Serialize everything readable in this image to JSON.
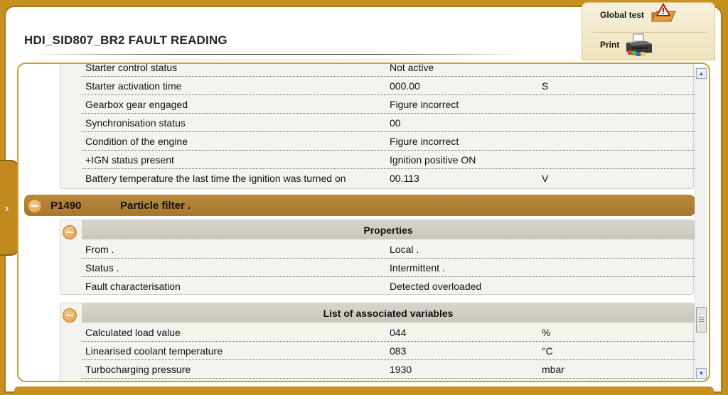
{
  "header": {
    "title": "HDI_SID807_BR2  FAULT READING"
  },
  "toolbar": {
    "global_test_label": "Global test",
    "print_label": "Print"
  },
  "top_rows": [
    {
      "name": "Starter control status",
      "value": "Not active",
      "unit": ""
    },
    {
      "name": "Starter activation time",
      "value": "000.00",
      "unit": "S"
    },
    {
      "name": "Gearbox gear engaged",
      "value": "Figure incorrect",
      "unit": ""
    },
    {
      "name": "Synchronisation status",
      "value": "00",
      "unit": ""
    },
    {
      "name": "Condition of the engine",
      "value": "Figure incorrect",
      "unit": ""
    },
    {
      "name": "+IGN status present",
      "value": "Ignition positive ON",
      "unit": ""
    },
    {
      "name": "Battery temperature the last time the ignition was turned on",
      "value": "00.113",
      "unit": "V"
    }
  ],
  "fault": {
    "code": "P1490",
    "name": "Particle filter ."
  },
  "properties": {
    "header": "Properties",
    "rows": [
      {
        "name": "From .",
        "value": "Local ."
      },
      {
        "name": "Status .",
        "value": "Intermittent ."
      },
      {
        "name": "Fault characterisation",
        "value": "Detected overloaded"
      }
    ]
  },
  "variables": {
    "header": "List of associated variables",
    "rows": [
      {
        "name": "Calculated load value",
        "value": "044",
        "unit": "%"
      },
      {
        "name": "Linearised coolant temperature",
        "value": "083",
        "unit": "°C"
      },
      {
        "name": "Turbocharging pressure",
        "value": "1930",
        "unit": "mbar"
      }
    ]
  },
  "colors": {
    "frame": "#c8901c",
    "fault_bar": "#a8792c",
    "minus_button": "#e39a42"
  },
  "icons": {
    "global_test": "warning-folder-icon",
    "print": "printer-icon",
    "side_tab": "chevron-right-icon",
    "collapse": "minus-circle-icon"
  }
}
